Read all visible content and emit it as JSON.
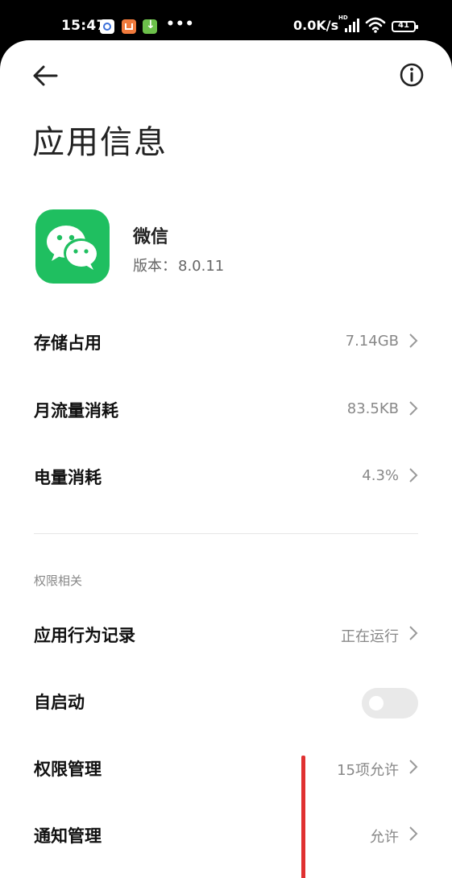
{
  "status_bar": {
    "time": "15:47",
    "dots": "•••",
    "network_speed": "0.0K/s",
    "signal_label": "HD",
    "battery": "41",
    "app_icons": [
      "baidu-icon",
      "shop-icon",
      "download-icon"
    ]
  },
  "header": {
    "title": "应用信息"
  },
  "app": {
    "name": "微信",
    "version_label": "版本：",
    "version": "8.0.11",
    "icon_color": "#1fbf60"
  },
  "usage": [
    {
      "label": "存储占用",
      "value": "7.14GB"
    },
    {
      "label": "月流量消耗",
      "value": "83.5KB"
    },
    {
      "label": "电量消耗",
      "value": "4.3%"
    }
  ],
  "permissions": {
    "section_title": "权限相关",
    "items": [
      {
        "label": "应用行为记录",
        "value": "正在运行"
      },
      {
        "label": "自启动",
        "toggle": false
      },
      {
        "label": "权限管理",
        "value": "15项允许"
      },
      {
        "label": "通知管理",
        "value": "允许"
      }
    ]
  },
  "colors": {
    "accent_red": "#e03131",
    "text_primary": "#111111",
    "text_secondary": "#888888"
  }
}
